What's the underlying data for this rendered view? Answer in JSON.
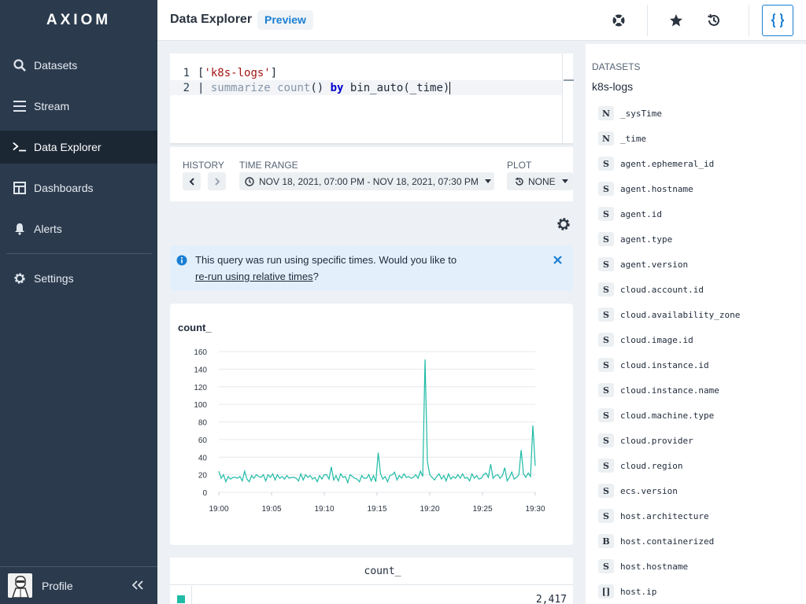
{
  "app": {
    "logo": "AXIOM"
  },
  "sidebar": {
    "items": [
      {
        "label": "Datasets",
        "icon": "search-icon"
      },
      {
        "label": "Stream",
        "icon": "stream-icon"
      },
      {
        "label": "Data Explorer",
        "icon": "terminal-icon"
      },
      {
        "label": "Dashboards",
        "icon": "dashboard-icon"
      },
      {
        "label": "Alerts",
        "icon": "bell-icon"
      },
      {
        "label": "Settings",
        "icon": "gear-icon"
      }
    ],
    "profile_label": "Profile"
  },
  "header": {
    "title": "Data Explorer",
    "badge": "Preview"
  },
  "editor": {
    "lines": [
      {
        "num": "1",
        "open": "[",
        "dataset": "'k8s-logs'",
        "close": "]"
      },
      {
        "num": "2",
        "pipe": "| ",
        "kw1": "summarize",
        "sp1": " ",
        "kw2": "count",
        "paren": "() ",
        "by": "by",
        "rest": " bin_auto(_time)"
      }
    ]
  },
  "querybar": {
    "history_label": "HISTORY",
    "time_range_label": "TIME RANGE",
    "time_range_value": "NOV 18, 2021, 07:00 PM - NOV 18, 2021, 07:30 PM",
    "plot_against_label": "PLOT AGAINST",
    "plot_against_value": "NONE"
  },
  "info": {
    "text": "This query was run using specific times. Would you like to",
    "link": "re-run using relative times",
    "suffix": "?"
  },
  "chart_data": {
    "type": "line",
    "title": "count_",
    "xlabel": "",
    "ylabel": "",
    "ylim": [
      0,
      160
    ],
    "yticks": [
      0,
      20,
      40,
      60,
      80,
      100,
      120,
      140,
      160
    ],
    "xtick_labels": [
      "19:00",
      "19:05",
      "19:10",
      "19:15",
      "19:20",
      "19:25",
      "19:30"
    ],
    "xlim_minutes": [
      0,
      30
    ],
    "color": "#1fbba6",
    "grid": true,
    "series": [
      {
        "values": [
          24,
          16,
          20,
          12,
          18,
          15,
          17,
          17,
          16,
          18,
          13,
          24,
          15,
          12,
          19,
          16,
          20,
          18,
          17,
          20,
          13,
          20,
          17,
          21,
          14,
          20,
          16,
          18,
          15,
          19,
          16,
          17,
          17,
          16,
          13,
          21,
          14,
          20,
          17,
          19,
          15,
          17,
          12,
          19,
          15,
          20,
          20,
          15,
          29,
          14,
          19,
          13,
          21,
          17,
          18,
          11,
          20,
          18,
          16,
          15,
          12,
          19,
          16,
          16,
          20,
          13,
          19,
          12,
          45,
          21,
          15,
          18,
          12,
          19,
          20,
          23,
          14,
          19,
          16,
          21,
          17,
          18,
          16,
          17,
          20,
          16,
          24,
          18,
          151,
          35,
          20,
          17,
          14,
          18,
          21,
          15,
          19,
          13,
          21,
          15,
          18,
          16,
          20,
          16,
          21,
          16,
          17,
          13,
          21,
          16,
          19,
          15,
          16,
          20,
          22,
          17,
          32,
          16,
          19,
          20,
          16,
          19,
          28,
          13,
          17,
          23,
          15,
          17,
          20,
          48,
          21,
          17,
          22,
          18,
          76,
          30
        ]
      }
    ]
  },
  "table": {
    "header": "count_",
    "rows": [
      {
        "value": "2,417"
      }
    ]
  },
  "datasets_panel": {
    "heading": "DATASETS",
    "dataset": "k8s-logs",
    "fields": [
      {
        "type": "N",
        "name": "_sysTime"
      },
      {
        "type": "N",
        "name": "_time"
      },
      {
        "type": "S",
        "name": "agent.ephemeral_id"
      },
      {
        "type": "S",
        "name": "agent.hostname"
      },
      {
        "type": "S",
        "name": "agent.id"
      },
      {
        "type": "S",
        "name": "agent.type"
      },
      {
        "type": "S",
        "name": "agent.version"
      },
      {
        "type": "S",
        "name": "cloud.account.id"
      },
      {
        "type": "S",
        "name": "cloud.availability_zone"
      },
      {
        "type": "S",
        "name": "cloud.image.id"
      },
      {
        "type": "S",
        "name": "cloud.instance.id"
      },
      {
        "type": "S",
        "name": "cloud.instance.name"
      },
      {
        "type": "S",
        "name": "cloud.machine.type"
      },
      {
        "type": "S",
        "name": "cloud.provider"
      },
      {
        "type": "S",
        "name": "cloud.region"
      },
      {
        "type": "S",
        "name": "ecs.version"
      },
      {
        "type": "S",
        "name": "host.architecture"
      },
      {
        "type": "B",
        "name": "host.containerized"
      },
      {
        "type": "S",
        "name": "host.hostname"
      },
      {
        "type": "[]",
        "name": "host.ip"
      }
    ]
  }
}
